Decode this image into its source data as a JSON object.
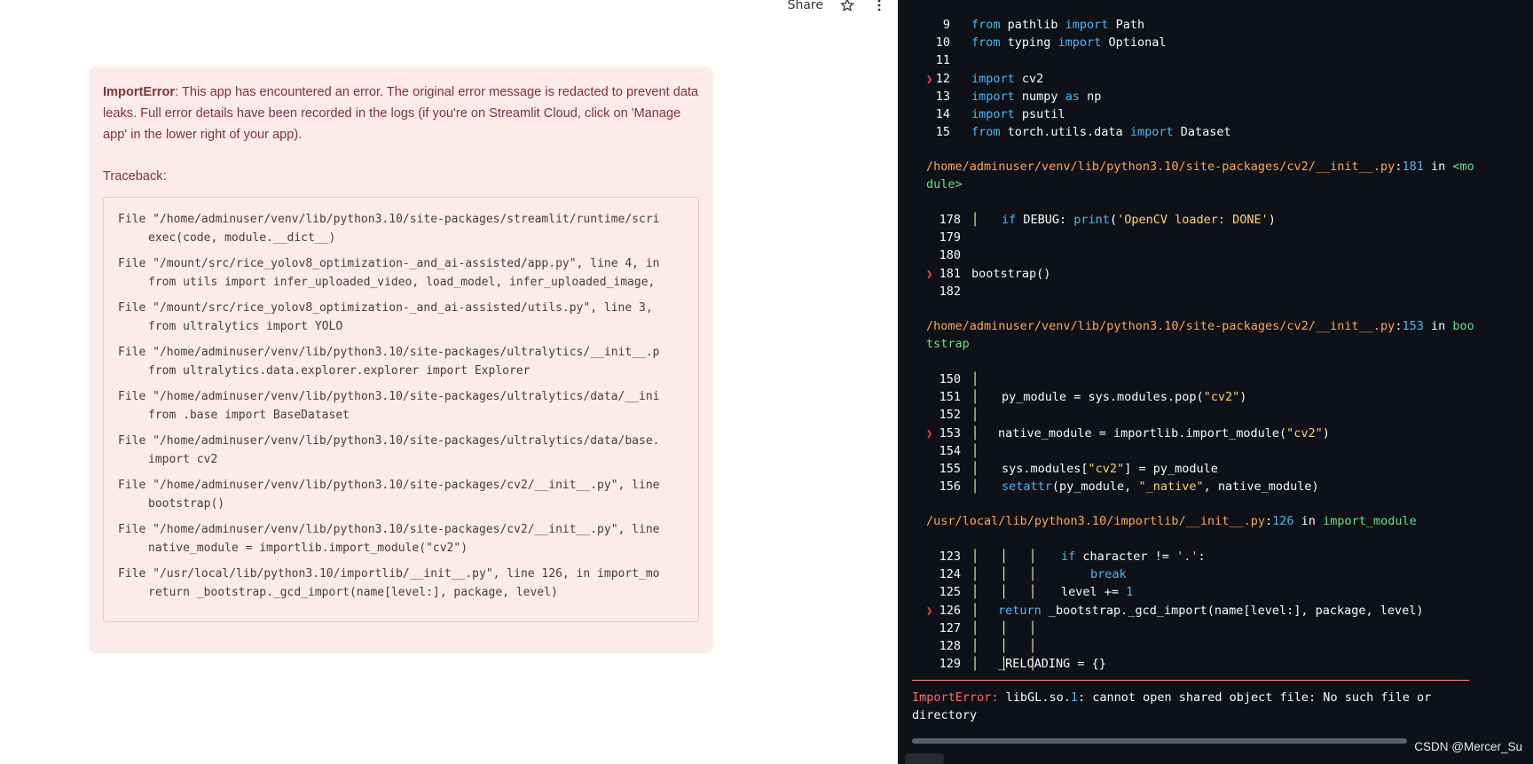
{
  "toolbar": {
    "share_label": "Share",
    "star_icon": "star-icon",
    "menu_icon": "kebab-menu-icon"
  },
  "error": {
    "type": "ImportError",
    "message": ": This app has encountered an error. The original error message is redacted to prevent data leaks. Full error details have been recorded in the logs (if you're on Streamlit Cloud, click on 'Manage app' in the lower right of your app).",
    "traceback_label": "Traceback:",
    "traceback": [
      {
        "file": "File \"/home/adminuser/venv/lib/python3.10/site-packages/streamlit/runtime/scri",
        "code": "exec(code, module.__dict__)"
      },
      {
        "file": "File \"/mount/src/rice_yolov8_optimization-_and_ai-assisted/app.py\", line 4, in",
        "code": "from utils import infer_uploaded_video, load_model, infer_uploaded_image,"
      },
      {
        "file": "File \"/mount/src/rice_yolov8_optimization-_and_ai-assisted/utils.py\", line 3,",
        "code": "from ultralytics import YOLO"
      },
      {
        "file": "File \"/home/adminuser/venv/lib/python3.10/site-packages/ultralytics/__init__.p",
        "code": "from ultralytics.data.explorer.explorer import Explorer"
      },
      {
        "file": "File \"/home/adminuser/venv/lib/python3.10/site-packages/ultralytics/data/__ini",
        "code": "from .base import BaseDataset"
      },
      {
        "file": "File \"/home/adminuser/venv/lib/python3.10/site-packages/ultralytics/data/base.",
        "code": "import cv2"
      },
      {
        "file": "File \"/home/adminuser/venv/lib/python3.10/site-packages/cv2/__init__.py\", line",
        "code": "bootstrap()"
      },
      {
        "file": "File \"/home/adminuser/venv/lib/python3.10/site-packages/cv2/__init__.py\", line",
        "code": "native_module = importlib.import_module(\"cv2\")"
      },
      {
        "file": "File \"/usr/local/lib/python3.10/importlib/__init__.py\", line 126, in import_mo",
        "code": "return _bootstrap._gcd_import(name[level:], package, level)"
      }
    ]
  },
  "console": {
    "block1": [
      {
        "n": "9",
        "text": "from pathlib import Path"
      },
      {
        "n": "10",
        "text": "from typing import Optional"
      },
      {
        "n": "11",
        "text": ""
      },
      {
        "n": "12",
        "text": "import cv2",
        "current": true
      },
      {
        "n": "13",
        "text": "import numpy as np"
      },
      {
        "n": "14",
        "text": "import psutil"
      },
      {
        "n": "15",
        "text": "from torch.utils.data import Dataset"
      }
    ],
    "frame2": {
      "path": "/home/adminuser/venv/lib/python3.10/site-packages/cv2/__init__.py",
      "line": "181",
      "in": " in ",
      "func": "<module>"
    },
    "block2": [
      {
        "n": "178",
        "text": "if DEBUG: print('OpenCV loader: DONE')"
      },
      {
        "n": "179",
        "text": ""
      },
      {
        "n": "180",
        "text": ""
      },
      {
        "n": "181",
        "text": "bootstrap()",
        "current": true
      },
      {
        "n": "182",
        "text": ""
      }
    ],
    "frame3": {
      "path": "/home/adminuser/venv/lib/python3.10/site-packages/cv2/__init__.py",
      "line": "153",
      "in": " in ",
      "func": "bootstrap"
    },
    "block3": [
      {
        "n": "150",
        "text": ""
      },
      {
        "n": "151",
        "text": "py_module = sys.modules.pop(\"cv2\")"
      },
      {
        "n": "152",
        "text": ""
      },
      {
        "n": "153",
        "text": "native_module = importlib.import_module(\"cv2\")",
        "current": true
      },
      {
        "n": "154",
        "text": ""
      },
      {
        "n": "155",
        "text": "sys.modules[\"cv2\"] = py_module"
      },
      {
        "n": "156",
        "text": "setattr(py_module, \"_native\", native_module)"
      }
    ],
    "frame4": {
      "path": "/usr/local/lib/python3.10/importlib/__init__.py",
      "line": "126",
      "in": " in ",
      "func": "import_module"
    },
    "block4": [
      {
        "n": "123",
        "text": "if character != '.':"
      },
      {
        "n": "124",
        "text": "break"
      },
      {
        "n": "125",
        "text": "level += 1"
      },
      {
        "n": "126",
        "text": "return _bootstrap._gcd_import(name[level:], package, level)",
        "current": true
      },
      {
        "n": "127",
        "text": ""
      },
      {
        "n": "128",
        "text": ""
      },
      {
        "n": "129",
        "text": "_RELOADING = {}"
      }
    ],
    "final_error_type": "ImportError:",
    "final_error_msg": " libGL.so.1: cannot open shared object file: No such file or directory"
  },
  "watermark": "CSDN @Mercer_Su",
  "colors": {
    "error_bg": "#fdeaea",
    "error_text": "#7d353b",
    "console_bg": "#0e1117",
    "keyword": "#4cb6f5",
    "string": "#ffd16a",
    "path": "#ffa657",
    "func": "#66e08a",
    "arrow": "#ff4b4b"
  }
}
